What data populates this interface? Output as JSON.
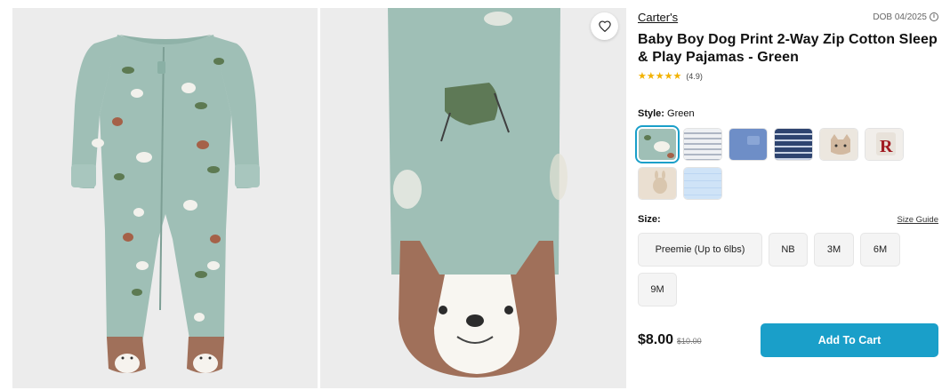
{
  "product": {
    "brand": "Carter's",
    "dob": "DOB 04/2025",
    "title": "Baby Boy Dog Print 2-Way Zip Cotton Sleep & Play Pajamas - Green",
    "rating_stars": "★★★★★",
    "rating_value": "(4.9)",
    "rating": 4.9
  },
  "gallery": {
    "icons": [
      "heart-icon"
    ]
  },
  "style": {
    "label": "Style:",
    "selected": "Green",
    "swatches": [
      {
        "name": "green-dog",
        "color": "#9fbfb6",
        "selected": true
      },
      {
        "name": "grey-stripe",
        "color": "#d9dde3"
      },
      {
        "name": "blue-solid",
        "color": "#6e8ec7"
      },
      {
        "name": "navy-stripe",
        "color": "#2e4470"
      },
      {
        "name": "cat-face",
        "color": "#ece7df"
      },
      {
        "name": "red-letter",
        "color": "#f1eeea"
      },
      {
        "name": "cream-bunny",
        "color": "#eadfd1"
      },
      {
        "name": "light-blue",
        "color": "#cfe3f7"
      }
    ]
  },
  "size": {
    "label": "Size:",
    "guide": "Size Guide",
    "options": [
      "Preemie (Up to 6lbs)",
      "NB",
      "3M",
      "6M",
      "9M"
    ]
  },
  "buy": {
    "price": "$8.00",
    "price_old": "$10.00",
    "cart_label": "Add To Cart"
  },
  "colors": {
    "accent": "#1a9fc9",
    "star": "#f2b200",
    "fabric": "#9fbfb6"
  }
}
